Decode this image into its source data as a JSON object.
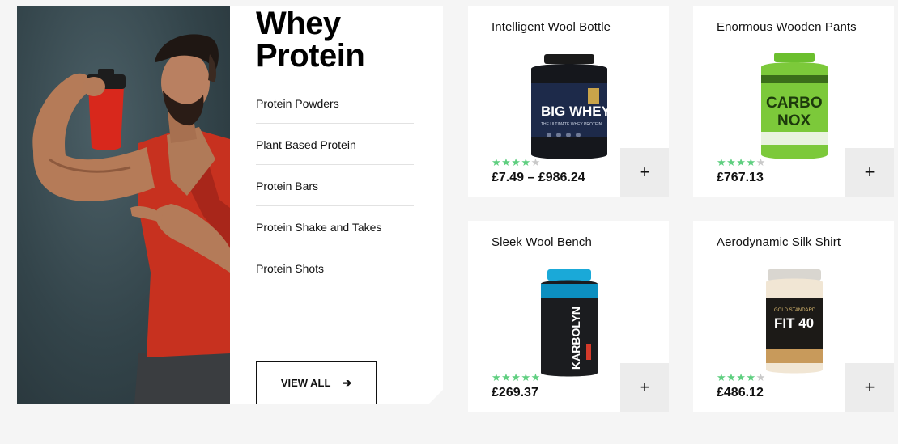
{
  "category": {
    "title_line1": "Whey",
    "title_line2": "Protein",
    "links": [
      "Protein Powders",
      "Plant Based Protein",
      "Protein Bars",
      "Protein Shake and Takes",
      "Protein Shots"
    ],
    "view_all_label": "VIEW ALL",
    "view_all_icon": "arrow-right-icon"
  },
  "products": [
    {
      "name": "Intelligent Wool Bottle",
      "price": "£7.49 – £986.24",
      "rating": 3.5,
      "label_top": "BIG WHEY",
      "label_sub": "THE ULTIMATE WHEY PROTEIN"
    },
    {
      "name": "Enormous Wooden Pants",
      "price": "£767.13",
      "rating": 4,
      "label_top": "CARBO",
      "label_sub": "NOX"
    },
    {
      "name": "Sleek Wool Bench",
      "price": "£269.37",
      "rating": 4.5,
      "label_top": "KARBOLYN",
      "label_sub": ""
    },
    {
      "name": "Aerodynamic Silk Shirt",
      "price": "£486.12",
      "rating": 4,
      "label_top": "GOLD STANDARD",
      "label_sub": "FIT 40"
    }
  ],
  "add_button_label": "+",
  "colors": {
    "star": "#5fcf80",
    "star_off": "#c9c9c9",
    "add_bg": "#ececec",
    "page_bg": "#f5f5f5"
  }
}
